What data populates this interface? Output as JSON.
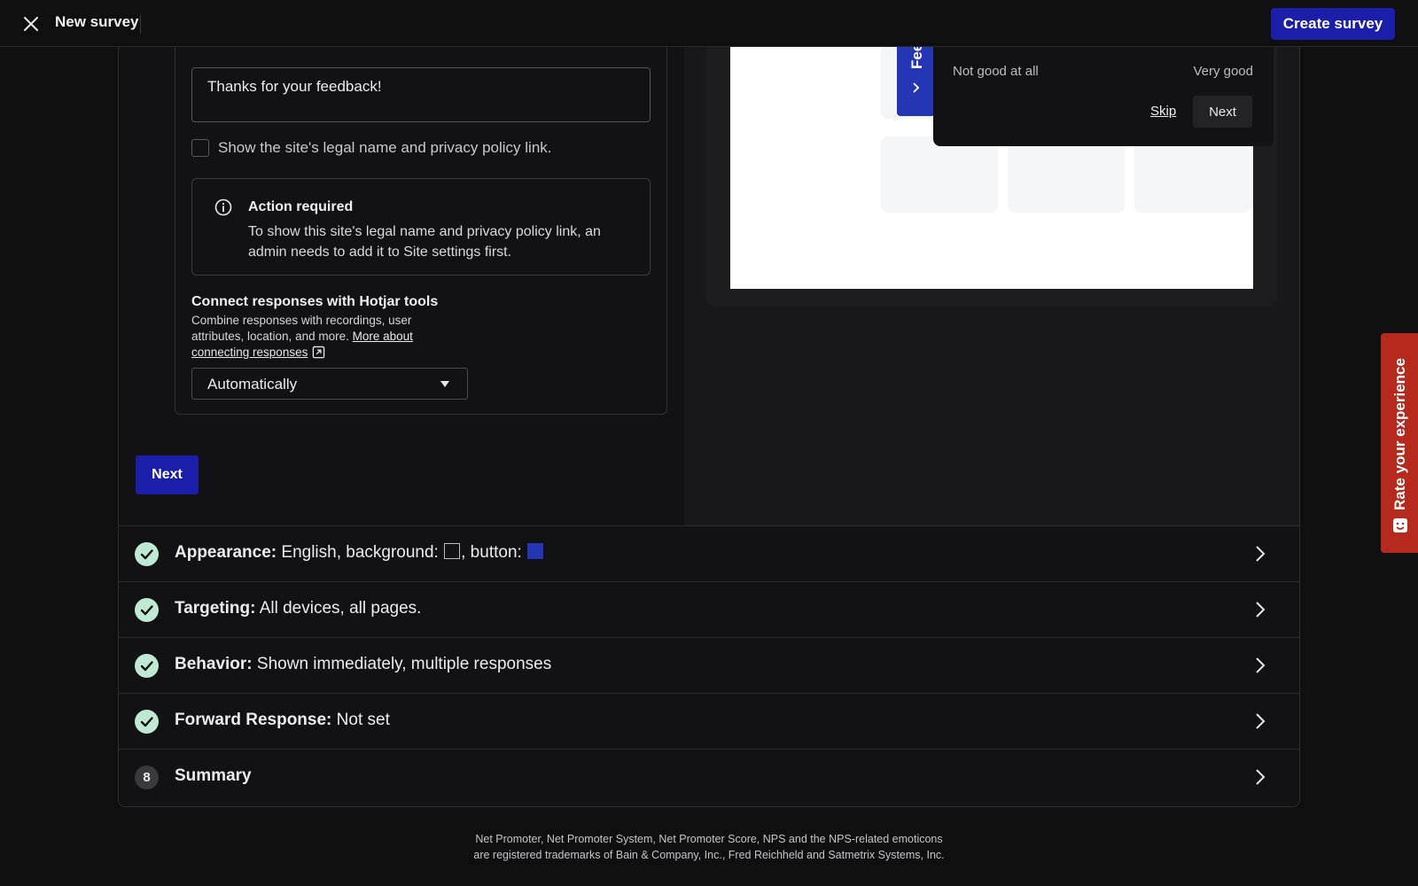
{
  "topbar": {
    "title": "New survey",
    "create_label": "Create survey"
  },
  "form": {
    "thanks_value": "Thanks for your feedback!",
    "legal_checkbox_label": "Show the site's legal name and privacy policy link.",
    "legal_checked": false,
    "alert": {
      "title": "Action required",
      "body": "To show this site's legal name and privacy policy link, an admin needs to add it to Site settings first."
    },
    "connect": {
      "title": "Connect responses with Hotjar tools",
      "body": "Combine responses with recordings, user attributes, location, and more.",
      "link_label": "More about connecting responses"
    },
    "select_value": "Automatically",
    "next_label": "Next"
  },
  "preview": {
    "feedback_tab_label": "Feedback",
    "scale_low": "Not good at all",
    "scale_high": "Very good",
    "skip_label": "Skip",
    "next_label": "Next"
  },
  "sections": {
    "appearance": {
      "label": "Appearance:",
      "value_pre": "English, background:",
      "value_mid": ", button:",
      "background_color": "#121214",
      "button_color": "#2536b5"
    },
    "targeting": {
      "label": "Targeting:",
      "value": "All devices, all pages."
    },
    "behavior": {
      "label": "Behavior:",
      "value": "Shown immediately, multiple responses"
    },
    "forward": {
      "label": "Forward Response:",
      "value": "Not set"
    },
    "summary": {
      "step": "8",
      "label": "Summary"
    }
  },
  "footer": {
    "line1": "Net Promoter, Net Promoter System, Net Promoter Score, NPS and the NPS-related emoticons",
    "line2": "are registered trademarks of Bain & Company, Inc., Fred Reichheld and Satmetrix Systems, Inc."
  },
  "rate_tab": {
    "label": "Rate your experience"
  },
  "colors": {
    "accent": "#1a1ea8",
    "check_bg": "#bfe9d3",
    "rate_tab": "#b52a1c"
  }
}
